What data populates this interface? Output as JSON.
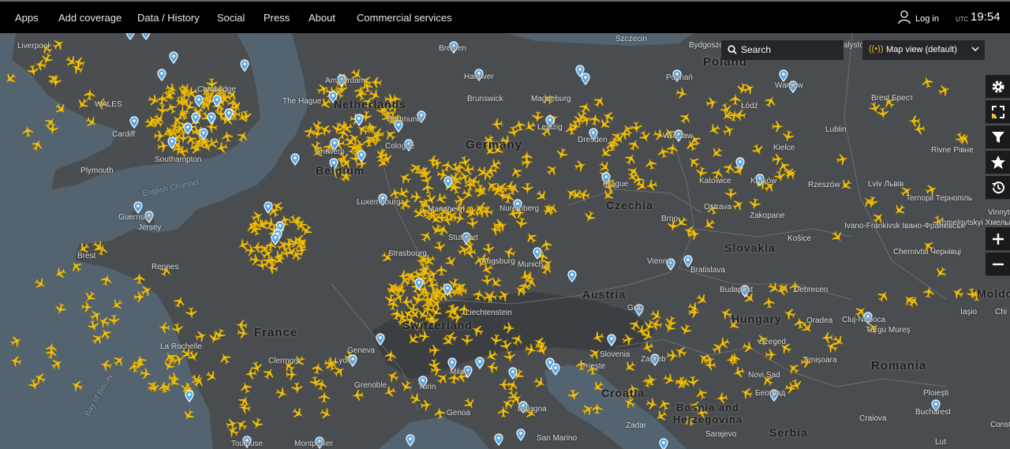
{
  "nav": {
    "items": [
      {
        "label": "Apps"
      },
      {
        "label": "Add coverage"
      },
      {
        "label": "Data / History"
      },
      {
        "label": "Social"
      },
      {
        "label": "Press"
      },
      {
        "label": "About"
      },
      {
        "label": "Commercial services"
      }
    ],
    "login_label": "Log in",
    "utc_label": "UTC",
    "time": "19:54"
  },
  "search": {
    "label": "Search"
  },
  "map_view": {
    "label": "Map view (default)"
  },
  "tools": [
    "settings-icon",
    "fullscreen-icon",
    "filter-icon",
    "bookmark-star-icon",
    "playback-icon",
    "zoom-in-icon",
    "zoom-out-icon"
  ],
  "colors": {
    "aircraft": "#f4c20d",
    "airport_pin": "#5aa9e6",
    "topbar": "#000000",
    "sea": "#536370",
    "land": "#4a4d50"
  },
  "map": {
    "countries": [
      "Poland",
      "Netherlands",
      "Germany",
      "Belgium",
      "Czechia",
      "Slovakia",
      "Austria",
      "Hungary",
      "Switzerland",
      "France",
      "Croatia",
      "Bosnia and Herzegovina",
      "Serbia",
      "Romania",
      "Moldo"
    ],
    "cities": [
      "Liverpool",
      "Cambridge",
      "WALES",
      "Cardiff",
      "Plymouth",
      "Southampton",
      "English Channel",
      "Guernsey",
      "Jersey",
      "Brest",
      "Rennes",
      "La Rochelle",
      "Bay of Biscay",
      "Bremen",
      "Hanover",
      "Brunswick",
      "Magdeburg",
      "Amsterdam",
      "The Hague",
      "Dortmund",
      "Antwerp",
      "Cologne",
      "Leipzig",
      "Dresden",
      "Mannheim",
      "Nuremberg",
      "Stuttgart",
      "Strasbourg",
      "Augsburg",
      "Munich",
      "Luxembourg",
      "Liechtenstein",
      "Geneva",
      "Clermont",
      "Lyon",
      "Grenoble",
      "Turin",
      "Milan",
      "Genoa",
      "Bologna",
      "San Marino",
      "Montpellier",
      "Toulouse",
      "Szczecin",
      "Bydgoszcz",
      "Bialystok",
      "Warsaw",
      "Poznań",
      "Łódź",
      "Wroclaw",
      "Lublin",
      "Kielce",
      "Katowice",
      "Kraków",
      "Rzeszów",
      "Brest Брест",
      "Lviv Львів",
      "Rivne Рівне",
      "Ternopil Тернопіль",
      "Khmelnytskyi Хмельницький",
      "Vinnyts",
      "Ivano-Frankivsk Івано-Франківськ",
      "Chernivtsi Чернівці",
      "Prague",
      "Brno",
      "Ostrava",
      "Zakopane",
      "Košice",
      "Vienna",
      "Bratislava",
      "Graz",
      "Budapest",
      "Debrecen",
      "Oradea",
      "Cluj-Napoca",
      "Târgu Mureş",
      "Iaşio",
      "Chi",
      "Szeged",
      "Timişoara",
      "Trieste",
      "Slovenia",
      "Zagreb",
      "Novi Sad",
      "Београд",
      "Craiova",
      "Ploieşti",
      "Bucharest",
      "Consta",
      "Zadar",
      "Sarajevo",
      "Lut"
    ]
  }
}
